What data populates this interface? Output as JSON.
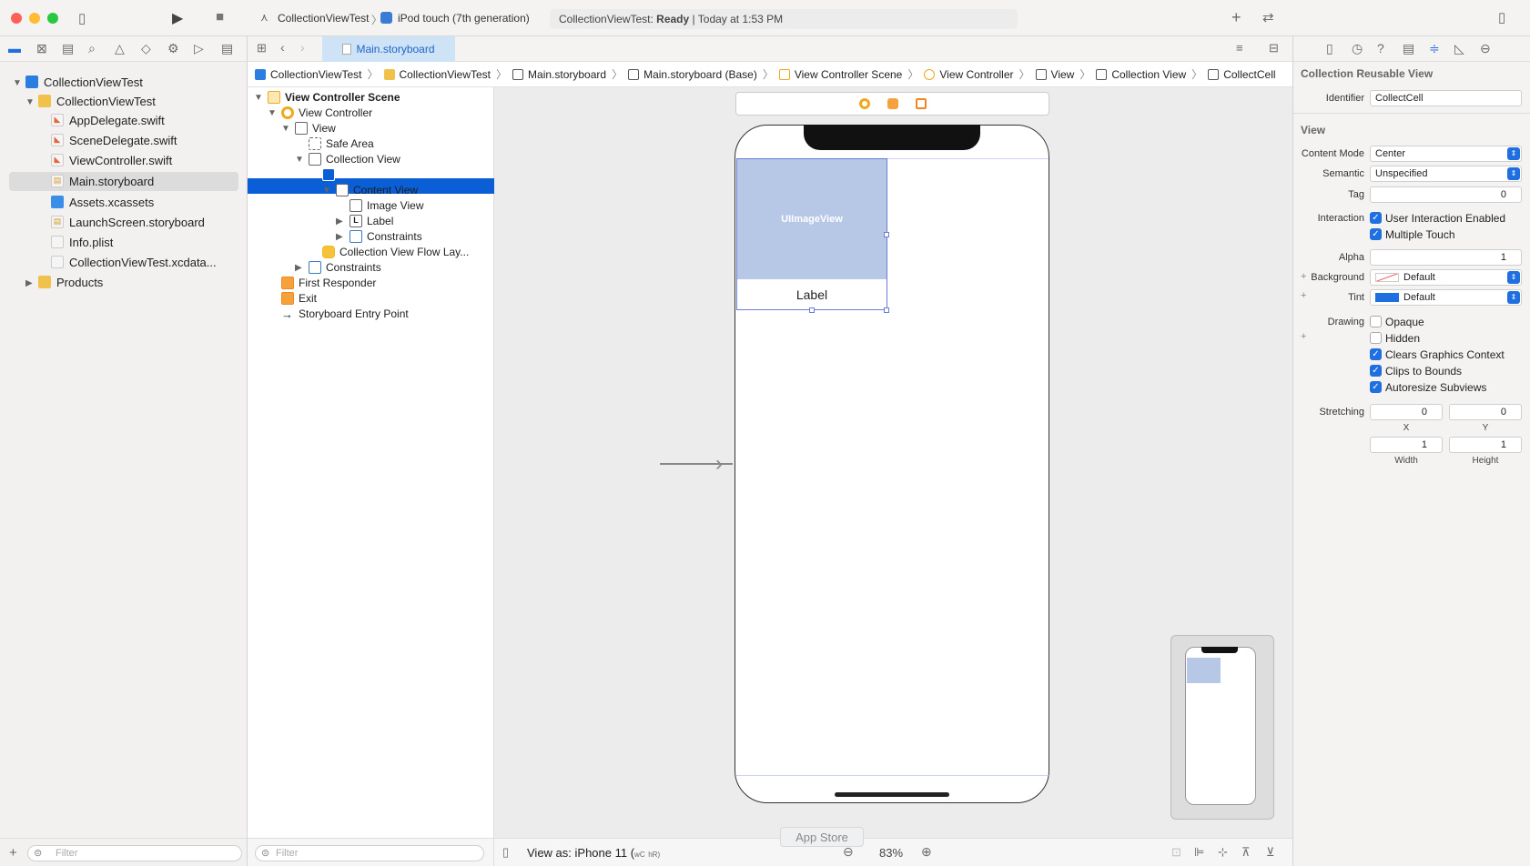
{
  "titlebar": {
    "scheme": "CollectionViewTest",
    "destination": "iPod touch (7th generation)",
    "status_app": "CollectionViewTest:",
    "status_state": "Ready",
    "status_time": "Today at 1:53 PM"
  },
  "navigator": {
    "project": "CollectionViewTest",
    "group": "CollectionViewTest",
    "files": [
      "AppDelegate.swift",
      "SceneDelegate.swift",
      "ViewController.swift",
      "Main.storyboard",
      "Assets.xcassets",
      "LaunchScreen.storyboard",
      "Info.plist",
      "CollectionViewTest.xcdata..."
    ],
    "products": "Products",
    "filter_placeholder": "Filter"
  },
  "editor": {
    "tab": "Main.storyboard",
    "breadcrumbs": [
      "CollectionViewTest",
      "CollectionViewTest",
      "Main.storyboard",
      "Main.storyboard (Base)",
      "View Controller Scene",
      "View Controller",
      "View",
      "Collection View",
      "CollectCell"
    ]
  },
  "outline": {
    "scene": "View Controller Scene",
    "view_controller": "View Controller",
    "view": "View",
    "safe_area": "Safe Area",
    "collection_view": "Collection View",
    "cell": "CollectCell",
    "content_view": "Content View",
    "image_view": "Image View",
    "label": "Label",
    "constraints_inner": "Constraints",
    "flow_layout": "Collection View Flow Lay...",
    "constraints_outer": "Constraints",
    "first_responder": "First Responder",
    "exit": "Exit",
    "entry_point": "Storyboard Entry Point",
    "filter_placeholder": "Filter"
  },
  "canvas": {
    "image_view_text": "UIImageView",
    "cell_label": "Label",
    "view_as": "View as: iPhone 11 (",
    "view_as_wc": "wC",
    "view_as_hr": "hR)",
    "app_store": "App Store",
    "zoom": "83%"
  },
  "inspector": {
    "section_reusable": "Collection Reusable View",
    "identifier_label": "Identifier",
    "identifier_value": "CollectCell",
    "section_view": "View",
    "content_mode_label": "Content Mode",
    "content_mode_value": "Center",
    "semantic_label": "Semantic",
    "semantic_value": "Unspecified",
    "tag_label": "Tag",
    "tag_value": "0",
    "interaction_label": "Interaction",
    "user_interaction": "User Interaction Enabled",
    "multiple_touch": "Multiple Touch",
    "alpha_label": "Alpha",
    "alpha_value": "1",
    "background_label": "Background",
    "background_value": "Default",
    "tint_label": "Tint",
    "tint_value": "Default",
    "drawing_label": "Drawing",
    "opaque": "Opaque",
    "hidden": "Hidden",
    "clears_graphics": "Clears Graphics Context",
    "clips_bounds": "Clips to Bounds",
    "autoresize": "Autoresize Subviews",
    "stretching_label": "Stretching",
    "stretch_x_value": "0",
    "stretch_y_value": "0",
    "stretch_x_label": "X",
    "stretch_y_label": "Y",
    "stretch_w_value": "1",
    "stretch_h_value": "1",
    "stretch_w_label": "Width",
    "stretch_h_label": "Height",
    "checks": {
      "user_interaction": true,
      "multiple_touch": true,
      "opaque": false,
      "hidden": false,
      "clears_graphics": true,
      "clips_bounds": true,
      "autoresize": true
    }
  },
  "colors": {
    "accent": "#0a5fd6",
    "tint": "#1f6fe0",
    "image_view": "#b6c8e6"
  }
}
